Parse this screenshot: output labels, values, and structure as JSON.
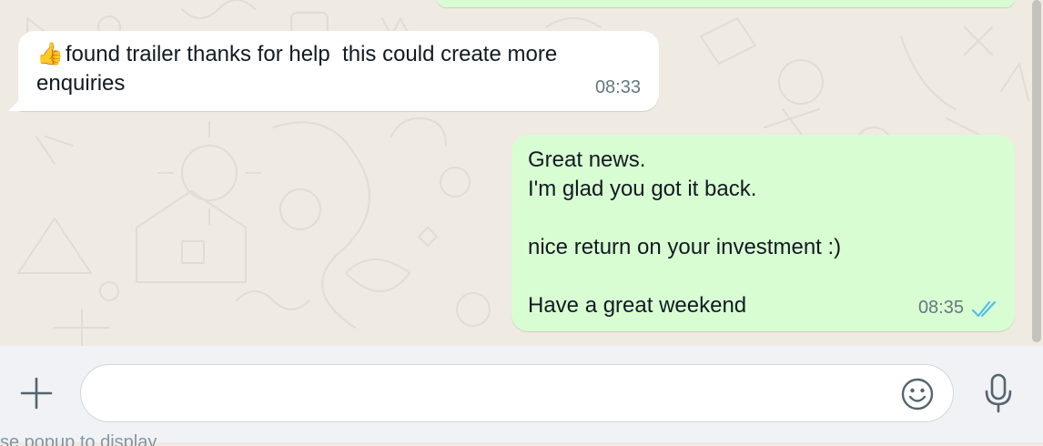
{
  "messages": [
    {
      "direction": "incoming",
      "emoji": "👍",
      "text": "found trailer thanks for help  this could create more\nenquiries",
      "time": "08:33"
    },
    {
      "direction": "outgoing",
      "text": "Great news.\nI'm glad you got it back.\n\nnice return on your investment :)\n\nHave a great weekend",
      "time": "08:35",
      "read_status_icon": "double-check-icon"
    }
  ],
  "composer": {
    "value": "",
    "placeholder": "",
    "attach_icon": "plus-icon",
    "emoji_icon": "smiley-icon",
    "voice_icon": "microphone-icon"
  },
  "underlay_text": "se popup to display",
  "colors": {
    "background": "#efeae2",
    "incoming_bubble": "#ffffff",
    "outgoing_bubble": "#d9fdd3",
    "read_ticks": "#53bdeb",
    "timestamp": "#667781"
  }
}
